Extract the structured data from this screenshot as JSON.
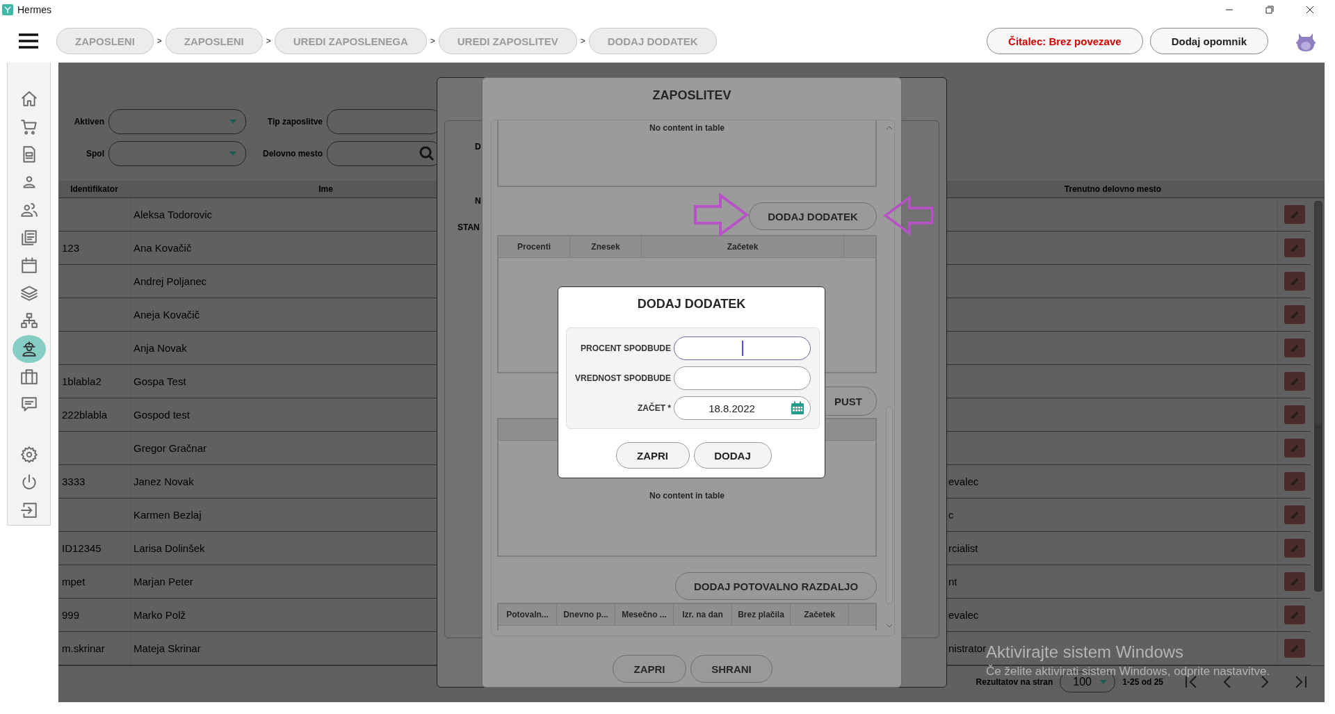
{
  "window": {
    "title": "Hermes"
  },
  "breadcrumbs": [
    {
      "label": "ZAPOSLENI"
    },
    {
      "label": "ZAPOSLENI",
      "separator": ">"
    },
    {
      "label": "UREDI ZAPOSLENEGA",
      "separator": ">"
    },
    {
      "label": "UREDI ZAPOSLITEV",
      "separator": ">"
    },
    {
      "label": "DODAJ DODATEK",
      "separator": ">"
    }
  ],
  "reader_status": "Čitalec: Brez povezave",
  "reminder_button": "Dodaj opomnik",
  "sidebar": {
    "items": [
      {
        "selected": false
      },
      {
        "selected": false
      },
      {
        "selected": false
      },
      {
        "selected": false
      },
      {
        "selected": false
      },
      {
        "selected": false
      },
      {
        "selected": false
      },
      {
        "selected": false
      },
      {
        "selected": false
      },
      {
        "selected": true
      },
      {
        "selected": false
      },
      {
        "selected": false
      }
    ],
    "bottom_items": [
      {
        "selected": false
      },
      {
        "selected": false
      },
      {
        "selected": false
      }
    ]
  },
  "filters": [
    {
      "label": "Aktiven",
      "kind": "dropdown"
    },
    {
      "label": "Tip zaposlitve",
      "kind": "text"
    },
    {
      "label": "Spol",
      "kind": "dropdown"
    },
    {
      "label": "Delovno mesto",
      "kind": "search"
    }
  ],
  "table": {
    "columns": [
      "Identifikator",
      "Ime",
      "Trenutno delovno mesto"
    ],
    "rows": [
      {
        "name": "Aleksa Todorovic"
      },
      {
        "id": "123",
        "name": "Ana Kovačič"
      },
      {
        "name": "Andrej Poljanec"
      },
      {
        "name": "Aneja  Kovačič"
      },
      {
        "name": "Anja Novak"
      },
      {
        "id": "1blabla2",
        "name": "Gospa Test"
      },
      {
        "id": "222blabla",
        "name": "Gospod test"
      },
      {
        "name": "Gregor Gračnar"
      },
      {
        "id": "3333",
        "name": "Janez Novak",
        "job": "evalec"
      },
      {
        "name": "Karmen Bezlaj",
        "job": "c"
      },
      {
        "id": "ID12345",
        "name": "Larisa Dolinšek",
        "job": "rcialist"
      },
      {
        "id": "mpet",
        "name": "Marjan Peter",
        "job": "nt"
      },
      {
        "id": "999",
        "name": "Marko Polž",
        "job": "evalec"
      },
      {
        "id": "m.skrinar",
        "name": "Mateja Skrinar",
        "job": "nistrator"
      }
    ]
  },
  "pager": {
    "label": "Rezultatov na stran",
    "page_size": "100",
    "range": "1-25 od 25"
  },
  "background_dialog": {
    "labels": [
      "D",
      "N",
      "STAN"
    ]
  },
  "employment_dialog": {
    "title": "ZAPOSLITEV",
    "first_table": {
      "empty_text": "No content in table"
    },
    "add_bonus_button": "DODAJ DODATEK",
    "bonus_table": {
      "columns": [
        "Procenti",
        "Znesek",
        "Začetek"
      ]
    },
    "partial_button": "PUST",
    "third_table": {
      "empty_text": "No content in table"
    },
    "add_travel_button": "DODAJ POTOVALNO RAZDALJO",
    "travel_table": {
      "columns": [
        "Potovaln...",
        "Dnevno p...",
        "Mesečno ...",
        "Izr. na dan",
        "Brez plačila",
        "Začetek"
      ]
    },
    "buttons": [
      "ZAPRI",
      "SHRANI"
    ]
  },
  "add_bonus_dialog": {
    "title": "DODAJ DODATEK",
    "fields": [
      {
        "label": "PROCENT SPODBUDE",
        "kind": "text",
        "focused": true
      },
      {
        "label": "VREDNOST SPODBUDE",
        "kind": "text",
        "focused": false
      },
      {
        "label": "ZAČET *",
        "kind": "date",
        "value": "18.8.2022",
        "focused": false
      }
    ],
    "buttons": [
      "ZAPRI",
      "DODAJ"
    ]
  },
  "windows_activation": {
    "title": "Aktivirajte sistem Windows",
    "text": "Če želite aktivirati sistem Windows, odprite nastavitve."
  }
}
